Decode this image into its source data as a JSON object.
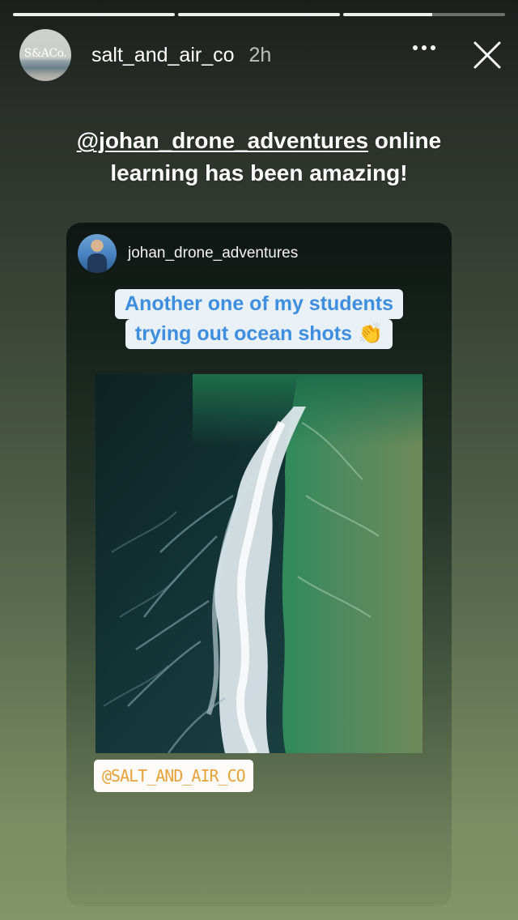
{
  "story": {
    "progress": [
      1.0,
      1.0,
      0.55
    ],
    "avatar_text": "S&ACo.",
    "username": "salt_and_air_co",
    "time": "2h",
    "caption": {
      "mention": "@johan_drone_adventures",
      "text": " online learning has been amazing!"
    }
  },
  "shared_post": {
    "username": "johan_drone_adventures",
    "sticker_lines": [
      "Another one of my students",
      "trying out ocean shots 👏"
    ],
    "tag": "@SALT_AND_AIR_CO"
  },
  "icons": {
    "more": "more-options-icon",
    "close": "close-icon"
  },
  "colors": {
    "sticker_text": "#3e8ee0",
    "tag_text": "#e7a137"
  }
}
